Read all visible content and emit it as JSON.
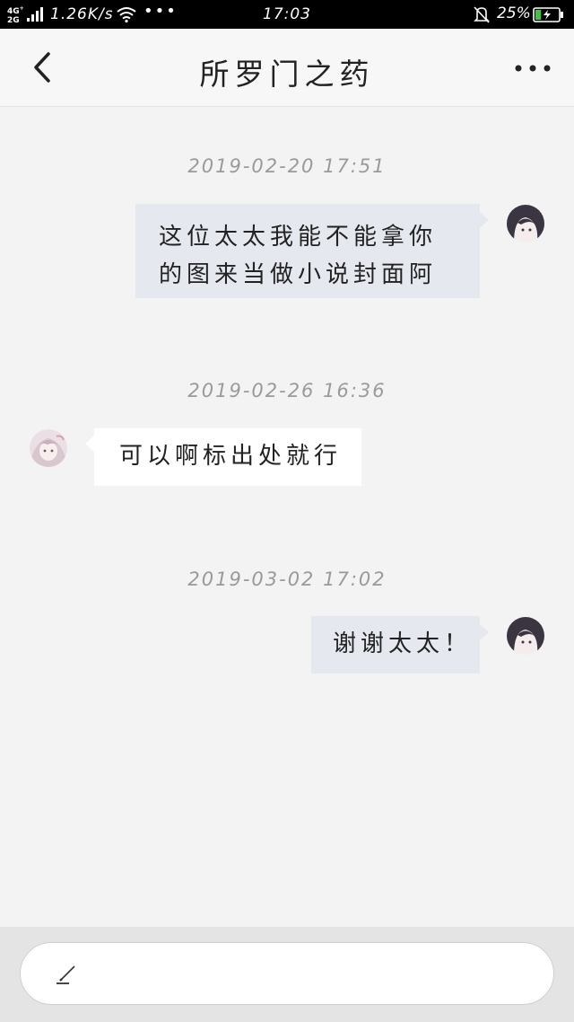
{
  "status_bar": {
    "network": "4G²\n2G",
    "speed": "1.26K/s",
    "more": "•••",
    "time": "17:03",
    "battery_percent": "25%",
    "battery_level": 0.25,
    "icons": [
      "signal-icon",
      "wifi-icon",
      "bell-muted-icon",
      "battery-charging-icon"
    ]
  },
  "header": {
    "title": "所罗门之药",
    "back_icon": "chevron-left-icon",
    "more_icon": "more-dots-icon"
  },
  "messages": [
    {
      "timestamp": "2019-02-20  17:51",
      "sender": "me",
      "text_lines": [
        "这位太太我能不能拿你",
        "的图来当做小说封面阿"
      ]
    },
    {
      "timestamp": "2019-02-26  16:36",
      "sender": "other",
      "text_lines": [
        "可以啊标出处就行"
      ]
    },
    {
      "timestamp": "2019-03-02  17:02",
      "sender": "me",
      "text_lines": [
        "谢谢太太！"
      ]
    }
  ],
  "input": {
    "placeholder": "",
    "icon": "pen-icon"
  },
  "colors": {
    "background": "#f3f3f3",
    "my_bubble": "#e5e8ee",
    "other_bubble": "#ffffff",
    "timestamp": "#9a9a9a"
  }
}
